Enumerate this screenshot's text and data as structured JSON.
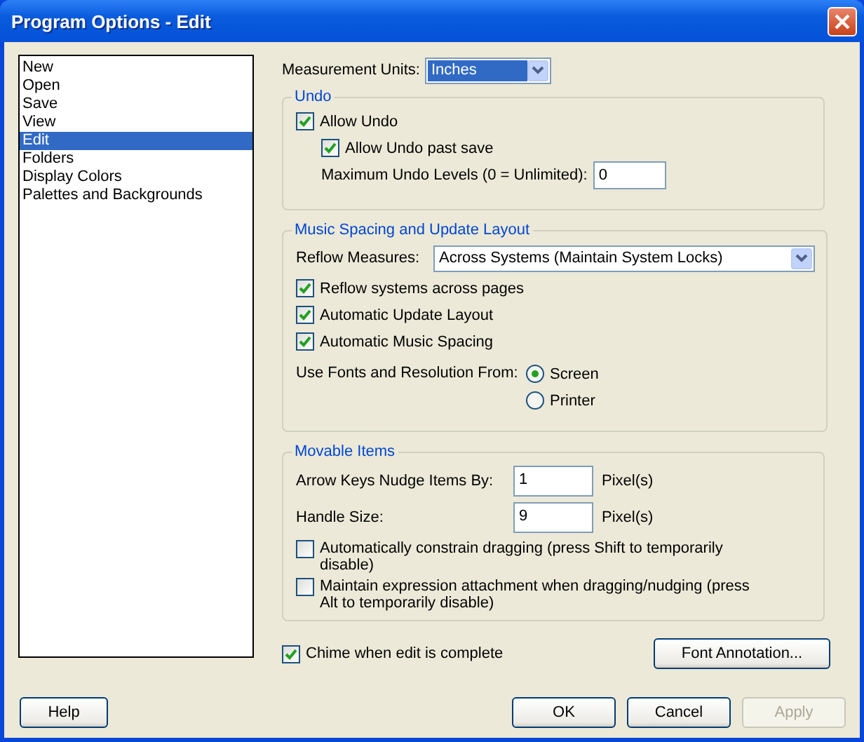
{
  "window": {
    "title": "Program Options - Edit"
  },
  "categories": [
    {
      "label": "New",
      "selected": false
    },
    {
      "label": "Open",
      "selected": false
    },
    {
      "label": "Save",
      "selected": false
    },
    {
      "label": "View",
      "selected": false
    },
    {
      "label": "Edit",
      "selected": true
    },
    {
      "label": "Folders",
      "selected": false
    },
    {
      "label": "Display Colors",
      "selected": false
    },
    {
      "label": "Palettes and Backgrounds",
      "selected": false
    }
  ],
  "measurement_units": {
    "label": "Measurement Units:",
    "value": "Inches"
  },
  "undo": {
    "title": "Undo",
    "allow_undo": {
      "label": "Allow Undo",
      "checked": true
    },
    "allow_undo_past_save": {
      "label": "Allow Undo past save",
      "checked": true
    },
    "max_levels": {
      "label": "Maximum Undo Levels (0 = Unlimited):",
      "value": "0"
    }
  },
  "music_spacing": {
    "title": "Music Spacing and Update Layout",
    "reflow_measures": {
      "label": "Reflow Measures:",
      "value": "Across Systems (Maintain System Locks)"
    },
    "options": [
      {
        "label": "Reflow systems across pages",
        "checked": true
      },
      {
        "label": "Automatic Update Layout",
        "checked": true
      },
      {
        "label": "Automatic Music Spacing",
        "checked": true
      }
    ],
    "fonts_from": {
      "label": "Use Fonts and Resolution From:",
      "options": [
        {
          "label": "Screen",
          "selected": true
        },
        {
          "label": "Printer",
          "selected": false
        }
      ]
    }
  },
  "movable_items": {
    "title": "Movable Items",
    "fields": [
      {
        "label": "Arrow Keys Nudge Items By:",
        "value": "1",
        "unit": "Pixel(s)"
      },
      {
        "label": "Handle Size:",
        "value": "9",
        "unit": "Pixel(s)"
      }
    ],
    "options": [
      {
        "label": "Automatically constrain dragging (press Shift to temporarily disable)",
        "checked": false
      },
      {
        "label": "Maintain expression attachment when dragging/nudging (press Alt to temporarily disable)",
        "checked": false
      }
    ]
  },
  "chime": {
    "label": "Chime when edit is complete",
    "checked": true
  },
  "font_annotation_button": {
    "label": "Font Annotation..."
  },
  "buttons": [
    {
      "label": "Help",
      "disabled": false
    },
    {
      "label": "OK",
      "disabled": false
    },
    {
      "label": "Cancel",
      "disabled": false
    },
    {
      "label": "Apply",
      "disabled": true
    }
  ]
}
